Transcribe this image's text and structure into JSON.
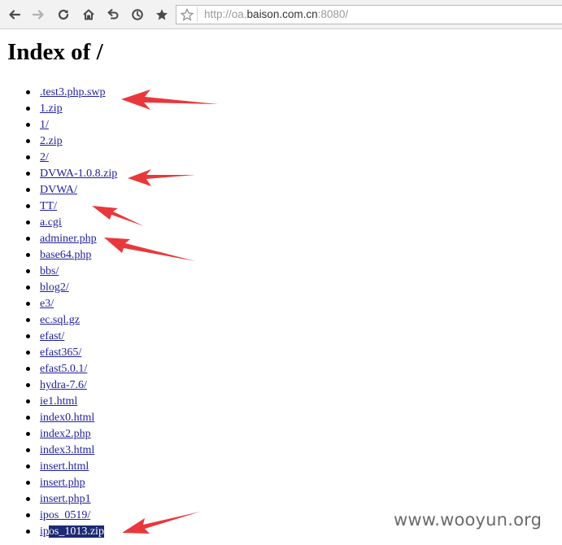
{
  "browser": {
    "address_scheme": "http://oa.",
    "address_host": "baison.com.cn",
    "address_rest": ":8080/"
  },
  "page": {
    "title": "Index of /"
  },
  "files": [
    ".test3.php.swp",
    "1.zip",
    "1/",
    "2.zip",
    "2/",
    "DVWA-1.0.8.zip",
    "DVWA/",
    "TT/",
    "a.cgi",
    "adminer.php",
    "base64.php",
    "bbs/",
    "blog2/",
    "e3/",
    "ec.sql.gz",
    "efast/",
    "efast365/",
    "efast5.0.1/",
    "hydra-7.6/",
    "ie1.html",
    "index0.html",
    "index2.php",
    "index3.html",
    "insert.html",
    "insert.php",
    "insert.php1",
    "ipos_0519/"
  ],
  "last_file": {
    "prefix": "ip",
    "selected": "os_1013.zip"
  },
  "watermark": "www.wooyun.org",
  "colors": {
    "link": "#1f1f9c",
    "selection": "#1d2a74",
    "arrow": "#e8383b"
  }
}
